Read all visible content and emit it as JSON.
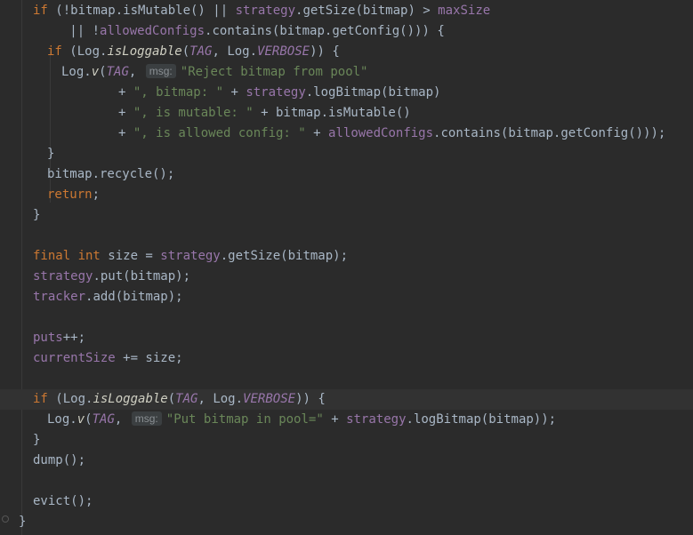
{
  "editor": {
    "language": "java",
    "theme": "dark",
    "hint_label": "msg:",
    "code": [
      {
        "indent": 37,
        "tokens": [
          [
            "kw",
            "if"
          ],
          [
            "id",
            " (!bitmap.isMutable() || "
          ],
          [
            "fld",
            "strategy"
          ],
          [
            "id",
            ".getSize(bitmap) > "
          ],
          [
            "fld",
            "maxSize"
          ]
        ]
      },
      {
        "indent": 53,
        "tokens": [
          [
            "id",
            "   || !"
          ],
          [
            "fld",
            "allowedConfigs"
          ],
          [
            "id",
            ".contains(bitmap.getConfig())) {"
          ]
        ]
      },
      {
        "indent": 53,
        "tokens": [
          [
            "kw",
            "if"
          ],
          [
            "id",
            " (Log."
          ],
          [
            "fni",
            "isLoggable"
          ],
          [
            "id",
            "("
          ],
          [
            "fldi",
            "TAG"
          ],
          [
            "id",
            ", Log."
          ],
          [
            "fldi",
            "VERBOSE"
          ],
          [
            "id",
            ")) {"
          ]
        ]
      },
      {
        "indent": 69,
        "tokens": [
          [
            "id",
            "Log."
          ],
          [
            "fni",
            "v"
          ],
          [
            "id",
            "("
          ],
          [
            "fldi",
            "TAG"
          ],
          [
            "id",
            ", "
          ],
          [
            "hint",
            "msg:"
          ],
          [
            "str",
            "\"Reject bitmap from pool\""
          ]
        ]
      },
      {
        "indent": 133,
        "tokens": [
          [
            "id",
            "+ "
          ],
          [
            "str",
            "\", bitmap: \""
          ],
          [
            "id",
            " + "
          ],
          [
            "fld",
            "strategy"
          ],
          [
            "id",
            ".logBitmap(bitmap)"
          ]
        ]
      },
      {
        "indent": 133,
        "tokens": [
          [
            "id",
            "+ "
          ],
          [
            "str",
            "\", is mutable: \""
          ],
          [
            "id",
            " + bitmap.isMutable()"
          ]
        ]
      },
      {
        "indent": 133,
        "tokens": [
          [
            "id",
            "+ "
          ],
          [
            "str",
            "\", is allowed config: \""
          ],
          [
            "id",
            " + "
          ],
          [
            "fld",
            "allowedConfigs"
          ],
          [
            "id",
            ".contains(bitmap.getConfig()));"
          ]
        ]
      },
      {
        "indent": 53,
        "tokens": [
          [
            "id",
            "}"
          ]
        ]
      },
      {
        "indent": 53,
        "tokens": [
          [
            "id",
            "bitmap.recycle();"
          ]
        ]
      },
      {
        "indent": 53,
        "tokens": [
          [
            "kw",
            "return"
          ],
          [
            "id",
            ";"
          ]
        ]
      },
      {
        "indent": 37,
        "tokens": [
          [
            "id",
            "}"
          ]
        ]
      },
      {
        "indent": 37,
        "tokens": []
      },
      {
        "indent": 37,
        "tokens": [
          [
            "kw",
            "final int"
          ],
          [
            "id",
            " size = "
          ],
          [
            "fld",
            "strategy"
          ],
          [
            "id",
            ".getSize(bitmap);"
          ]
        ]
      },
      {
        "indent": 37,
        "tokens": [
          [
            "fld",
            "strategy"
          ],
          [
            "id",
            ".put(bitmap);"
          ]
        ]
      },
      {
        "indent": 37,
        "tokens": [
          [
            "fld",
            "tracker"
          ],
          [
            "id",
            ".add(bitmap);"
          ]
        ]
      },
      {
        "indent": 37,
        "tokens": []
      },
      {
        "indent": 37,
        "tokens": [
          [
            "fld",
            "puts"
          ],
          [
            "id",
            "++;"
          ]
        ]
      },
      {
        "indent": 37,
        "tokens": [
          [
            "fld",
            "currentSize"
          ],
          [
            "id",
            " += size;"
          ]
        ]
      },
      {
        "indent": 37,
        "tokens": []
      },
      {
        "indent": 37,
        "highlight": true,
        "tokens": [
          [
            "kw",
            "if"
          ],
          [
            "id",
            " (Log."
          ],
          [
            "fni",
            "isLoggable"
          ],
          [
            "id",
            "("
          ],
          [
            "fldi",
            "TAG"
          ],
          [
            "id",
            ", Log."
          ],
          [
            "fldi",
            "VERBOSE"
          ],
          [
            "id",
            ")) {"
          ]
        ]
      },
      {
        "indent": 53,
        "tokens": [
          [
            "id",
            "Log."
          ],
          [
            "fni",
            "v"
          ],
          [
            "id",
            "("
          ],
          [
            "fldi",
            "TAG"
          ],
          [
            "id",
            ", "
          ],
          [
            "hint",
            "msg:"
          ],
          [
            "str",
            "\"Put bitmap in pool=\""
          ],
          [
            "id",
            " + "
          ],
          [
            "fld",
            "strategy"
          ],
          [
            "id",
            ".logBitmap(bitmap));"
          ]
        ]
      },
      {
        "indent": 37,
        "tokens": [
          [
            "id",
            "}"
          ]
        ]
      },
      {
        "indent": 37,
        "tokens": [
          [
            "id",
            "dump();"
          ]
        ]
      },
      {
        "indent": 37,
        "tokens": []
      },
      {
        "indent": 37,
        "tokens": [
          [
            "id",
            "evict();"
          ]
        ]
      },
      {
        "indent": 21,
        "tokens": [
          [
            "id",
            "}"
          ]
        ]
      }
    ]
  }
}
